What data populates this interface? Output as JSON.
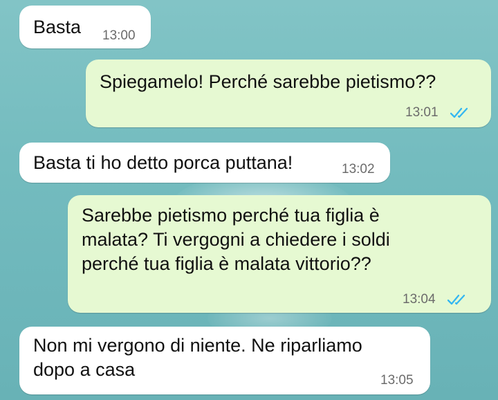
{
  "chat": {
    "messages": [
      {
        "direction": "incoming",
        "text": "Basta",
        "time": "13:00"
      },
      {
        "direction": "outgoing",
        "text": "Spiegamelo! Perché sarebbe pietismo??",
        "time": "13:01",
        "status": "read"
      },
      {
        "direction": "incoming",
        "text": "Basta ti ho detto porca puttana!",
        "time": "13:02"
      },
      {
        "direction": "outgoing",
        "text": "Sarebbe pietismo perché tua figlia è\nmalata? Ti vergogni a chiedere i soldi\nperché tua figlia è malata vittorio??",
        "time": "13:04",
        "status": "read"
      },
      {
        "direction": "incoming",
        "text": "Non mi vergono di niente. Ne riparliamo\ndopo a casa",
        "time": "13:05"
      }
    ]
  },
  "colors": {
    "incoming_bubble": "#ffffff",
    "outgoing_bubble": "#e6f9d2",
    "read_ticks": "#34b7f1",
    "wallpaper": "#74bcbf"
  },
  "icons": {
    "read_status": "double-check-icon"
  }
}
